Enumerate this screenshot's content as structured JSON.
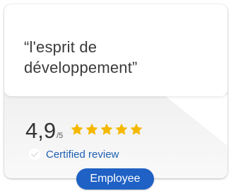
{
  "review": {
    "quote": "“l'esprit de développement”",
    "rating_value": "4,9",
    "rating_scale": "/5",
    "stars_filled": 5,
    "certified_label": "Certified review",
    "role_badge": "Employee"
  },
  "colors": {
    "star": "#f5b800",
    "badge": "#1f61c5",
    "certified_text": "#1e5fb3"
  },
  "icons": {
    "star": "star-icon",
    "check": "check-circle-icon"
  }
}
